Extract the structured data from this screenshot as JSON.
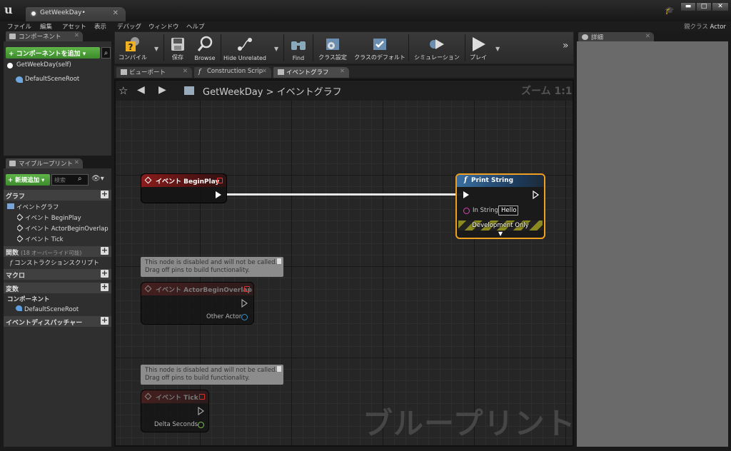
{
  "window": {
    "doc_tab": "GetWeekDay•",
    "parent_class_label": "親クラス",
    "parent_class_value": "Actor"
  },
  "menu": [
    "ファイル",
    "編集",
    "アセット",
    "表示",
    "デバッグ",
    "ウィンドウ",
    "ヘルプ"
  ],
  "components_panel": {
    "tab": "コンポーネント",
    "add_button": "+ コンポーネントを追加 ▾",
    "self_item": "GetWeekDay(self)",
    "root_item": "DefaultSceneRoot"
  },
  "my_blueprint": {
    "tab": "マイブループリント",
    "new_button": "+ 新規追加 ▾",
    "search_placeholder": "検索",
    "sections": {
      "graph": "グラフ",
      "functions": "関数",
      "functions_sub": "(18 オーバーライド可能)",
      "macros": "マクロ",
      "variables": "変数",
      "dispatchers": "イベントディスパッチャー"
    },
    "graph_items": {
      "event_graph": "イベントグラフ",
      "begin_play": "イベント BeginPlay",
      "begin_overlap": "イベント ActorBeginOverlap",
      "tick": "イベント Tick"
    },
    "construction_script": "コンストラクションスクリプト",
    "components_heading": "コンポーネント",
    "components_root": "DefaultSceneRoot"
  },
  "toolbar": {
    "compile": "コンパイル",
    "save": "保存",
    "browse": "Browse",
    "hide_unrelated": "Hide Unrelated",
    "find": "Find",
    "class_settings": "クラス設定",
    "class_defaults": "クラスのデフォルト",
    "simulation": "シミュレーション",
    "play": "プレイ"
  },
  "editor_tabs": {
    "viewport": "ビューポート",
    "construction": "Construction Scrip",
    "event_graph": "イベントグラフ"
  },
  "graph": {
    "breadcrumb_root": "GetWeekDay",
    "breadcrumb_sep": ">",
    "breadcrumb_leaf": "イベントグラフ",
    "zoom": "ズーム 1:1",
    "watermark": "ブループリント"
  },
  "nodes": {
    "begin_play": {
      "title": "イベント BeginPlay"
    },
    "print_string": {
      "title": "Print String",
      "in_string_label": "In String",
      "in_string_value": "Hello",
      "dev_only": "Development Only"
    },
    "begin_overlap": {
      "title": "イベント ActorBeginOverlap",
      "pin_other_actor": "Other Actor",
      "comment_line1": "This node is disabled and will not be called.",
      "comment_line2": "Drag off pins to build functionality."
    },
    "tick": {
      "title": "イベント Tick",
      "pin_delta": "Delta Seconds",
      "comment_line1": "This node is disabled and will not be called.",
      "comment_line2": "Drag off pins to build functionality."
    }
  },
  "details_panel": {
    "tab": "詳細"
  },
  "colors": {
    "add_green": "#4fa03a",
    "print_selected": "#f0a020",
    "event_red": "#8a1c1c",
    "function_blue": "#3a6fa0"
  }
}
